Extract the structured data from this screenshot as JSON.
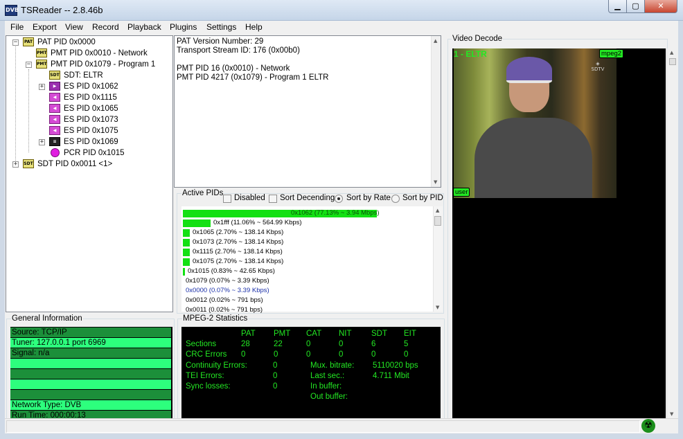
{
  "window": {
    "title": "TSReader -- 2.8.46b",
    "app_icon": "DVB"
  },
  "menu": [
    "File",
    "Export",
    "View",
    "Record",
    "Playback",
    "Plugins",
    "Settings",
    "Help"
  ],
  "tree": {
    "items": [
      {
        "label": "PAT PID 0x0000",
        "icon": "PAT"
      },
      {
        "label": "PMT PID 0x0010 - Network",
        "icon": "PMT"
      },
      {
        "label": "PMT PID 0x1079 - Program 1",
        "icon": "PMT"
      },
      {
        "label": "SDT: ELTR",
        "icon": "SDT"
      },
      {
        "label": "ES PID 0x1062",
        "icon": "video"
      },
      {
        "label": "ES PID 0x1115",
        "icon": "audio"
      },
      {
        "label": "ES PID 0x1065",
        "icon": "audio"
      },
      {
        "label": "ES PID 0x1073",
        "icon": "audio"
      },
      {
        "label": "ES PID 0x1075",
        "icon": "audio"
      },
      {
        "label": "ES PID 0x1069",
        "icon": "data"
      },
      {
        "label": "PCR PID 0x1015",
        "icon": "pcr"
      },
      {
        "label": "SDT PID 0x0011 <1>",
        "icon": "SDT"
      }
    ]
  },
  "detail": {
    "lines": [
      "PAT Version Number: 29",
      "Transport Stream ID: 176 (0x00b0)",
      "",
      "PMT PID 16 (0x0010) - Network",
      "PMT PID 4217 (0x1079) - Program 1 ELTR"
    ]
  },
  "active_pids": {
    "title": "Active PIDs",
    "options": {
      "disabled": "Disabled",
      "sort_desc": "Sort Decending",
      "sort_rate": "Sort by Rate",
      "sort_pid": "Sort by PID"
    },
    "rows": [
      {
        "text": "0x1062 (77.13% ~ 3.94 Mbps)",
        "percent": 77.13
      },
      {
        "text": "0x1fff (11.06% ~ 564.99 Kbps)",
        "percent": 11.06
      },
      {
        "text": "0x1065 (2.70% ~ 138.14 Kbps)",
        "percent": 2.7
      },
      {
        "text": "0x1073 (2.70% ~ 138.14 Kbps)",
        "percent": 2.7
      },
      {
        "text": "0x1115 (2.70% ~ 138.14 Kbps)",
        "percent": 2.7
      },
      {
        "text": "0x1075 (2.70% ~ 138.14 Kbps)",
        "percent": 2.7
      },
      {
        "text": "0x1015 (0.83% ~ 42.65 Kbps)",
        "percent": 0.83
      },
      {
        "text": "0x1079 (0.07% ~ 3.39 Kbps)",
        "percent": 0.07
      },
      {
        "text": "0x0000 (0.07% ~ 3.39 Kbps)",
        "percent": 0.07
      },
      {
        "text": "0x0012 (0.02% ~ 791 bps)",
        "percent": 0.02
      },
      {
        "text": "0x0011 (0.02% ~ 791 bps)",
        "percent": 0.02
      }
    ]
  },
  "general_info": {
    "title": "General Information",
    "rows": [
      "Source: TCP/IP",
      "Tuner: 127.0.0.1 port 6969",
      "Signal: n/a",
      "",
      "",
      "",
      "",
      "Network Type: DVB",
      "Run Time: 000:00:13"
    ]
  },
  "mpeg2_stats": {
    "title": "MPEG-2 Statistics",
    "headers": [
      "PAT",
      "PMT",
      "CAT",
      "NIT",
      "SDT",
      "EIT"
    ],
    "sections_label": "Sections",
    "sections": [
      "28",
      "22",
      "0",
      "0",
      "6",
      "5"
    ],
    "crc_label": "CRC Errors",
    "crc": [
      "0",
      "0",
      "0",
      "0",
      "0",
      "0"
    ],
    "continuity_label": "Continuity Errors:",
    "continuity": "0",
    "tei_label": "TEI Errors:",
    "tei": "0",
    "sync_label": "Sync losses:",
    "sync": "0",
    "mux_label": "Mux. bitrate:",
    "mux": "5110020 bps",
    "last_label": "Last sec.:",
    "last": "4.711 Mbit",
    "inbuf_label": "In buffer:",
    "outbuf_label": "Out buffer:"
  },
  "video": {
    "title": "Video Decode",
    "channel": "1 - ELTR",
    "codec": "mpeg2",
    "user_badge": "user",
    "logo": "SDTV"
  },
  "colors": {
    "green_text": "#23e823",
    "bar_green": "#13e013",
    "info_dark": "#1c8f3a",
    "info_light": "#2dff7d"
  }
}
